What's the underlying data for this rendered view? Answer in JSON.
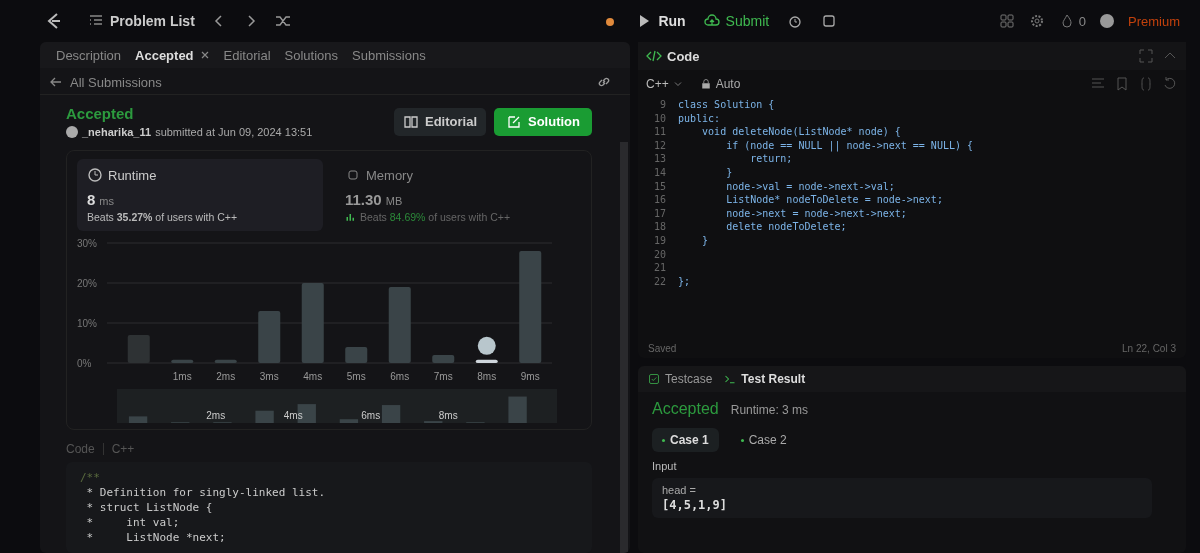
{
  "topbar": {
    "problem_list": "Problem List",
    "run": "Run",
    "submit": "Submit",
    "streak": "0",
    "premium": "Premium"
  },
  "left_tabs": [
    {
      "label": "Description",
      "selected": false,
      "closable": false
    },
    {
      "label": "Accepted",
      "selected": true,
      "closable": true
    },
    {
      "label": "Editorial",
      "selected": false,
      "closable": false
    },
    {
      "label": "Solutions",
      "selected": false,
      "closable": false
    },
    {
      "label": "Submissions",
      "selected": false,
      "closable": false
    }
  ],
  "back_link": "All Submissions",
  "submission": {
    "status": "Accepted",
    "user": "_neharika_11",
    "submitted": "submitted at Jun 09, 2024 13:51",
    "editorial_button": "Editorial",
    "solution_button": "Solution"
  },
  "stats": [
    {
      "kind": "runtime",
      "title": "Runtime",
      "value": "8",
      "unit": "ms",
      "beats": "Beats",
      "percent": "35.27%",
      "suffix": "of users with C++",
      "selected": true
    },
    {
      "kind": "memory",
      "title": "Memory",
      "value": "11.30",
      "unit": "MB",
      "beats": "Beats",
      "percent": "84.69%",
      "suffix": "of users with C++",
      "selected": false
    }
  ],
  "chart_data": {
    "type": "bar",
    "categories": [
      null,
      "1ms",
      "2ms",
      "3ms",
      "4ms",
      "5ms",
      "6ms",
      "7ms",
      "8ms",
      "9ms"
    ],
    "values": [
      7,
      0.8,
      0.8,
      13,
      20,
      4,
      19,
      2,
      0.8,
      28
    ],
    "ylim": [
      0,
      30
    ],
    "yticks": [
      {
        "value": 0,
        "label": "0%"
      },
      {
        "value": 10,
        "label": "10%"
      },
      {
        "value": 20,
        "label": "20%"
      },
      {
        "value": 30,
        "label": "30%"
      }
    ],
    "ylabel": null
  },
  "chart_bars": [
    {
      "selected": false
    },
    {
      "selected": false
    },
    {
      "selected": false
    },
    {
      "selected": false
    },
    {
      "selected": false
    },
    {
      "selected": false
    },
    {
      "selected": false
    },
    {
      "selected": false
    },
    {
      "selected": true
    },
    {
      "selected": false
    }
  ],
  "minimap_labels": [
    "2ms",
    "4ms",
    "6ms",
    "8ms"
  ],
  "code_view": {
    "tab": "Code",
    "language": "C++",
    "lines": [
      "/**",
      " * Definition for singly-linked list.",
      " * struct ListNode {",
      " *     int val;",
      " *     ListNode *next;"
    ]
  },
  "editor": {
    "title": "Code",
    "language": "C++",
    "mode": "Auto",
    "status": "Saved",
    "cursor": "Ln 22, Col 3",
    "lines": [
      {
        "number": "9",
        "text": "class Solution {"
      },
      {
        "number": "10",
        "text": "public:"
      },
      {
        "number": "11",
        "text": "    void deleteNode(ListNode* node) {"
      },
      {
        "number": "12",
        "text": "        if (node == NULL || node->next == NULL) {"
      },
      {
        "number": "13",
        "text": "            return;"
      },
      {
        "number": "14",
        "text": "        }"
      },
      {
        "number": "15",
        "text": "        node->val = node->next->val;"
      },
      {
        "number": "16",
        "text": "        ListNode* nodeToDelete = node->next;"
      },
      {
        "number": "17",
        "text": "        node->next = node->next->next;"
      },
      {
        "number": "18",
        "text": "        delete nodeToDelete;"
      },
      {
        "number": "19",
        "text": "    }"
      },
      {
        "number": "20"
      },
      {
        "number": "21"
      },
      {
        "number": "22",
        "text": "};"
      }
    ]
  },
  "test_panel": {
    "tabs": [
      {
        "label": "Testcase",
        "selected": false
      },
      {
        "label": "Test Result",
        "selected": true
      }
    ],
    "status": "Accepted",
    "runtime": "Runtime: 3 ms",
    "cases": [
      {
        "label": "Case 1",
        "selected": true
      },
      {
        "label": "Case 2",
        "selected": false
      }
    ],
    "input_label": "Input",
    "param": "head =",
    "value": "[4,5,1,9]"
  }
}
